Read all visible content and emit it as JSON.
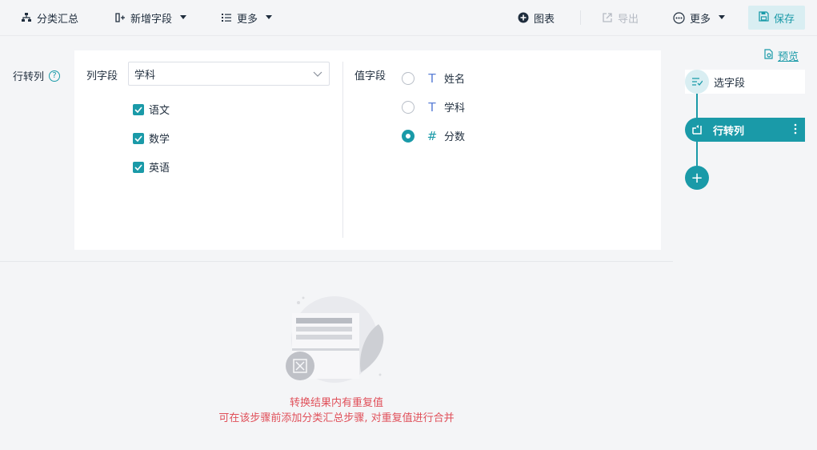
{
  "toolbar": {
    "group_summary": "分类汇总",
    "add_field": "新增字段",
    "more_left": "更多",
    "chart": "图表",
    "export": "导出",
    "more_right": "更多",
    "save": "保存"
  },
  "config": {
    "row_to_col_label": "行转列",
    "help_icon": "?",
    "column_field_label": "列字段",
    "column_field_value": "学科",
    "column_values": [
      {
        "label": "语文",
        "checked": true
      },
      {
        "label": "数学",
        "checked": true
      },
      {
        "label": "英语",
        "checked": true
      }
    ],
    "value_field_label": "值字段",
    "value_fields": [
      {
        "label": "姓名",
        "type": "T",
        "selected": false
      },
      {
        "label": "学科",
        "type": "T",
        "selected": false
      },
      {
        "label": "分数",
        "type": "#",
        "selected": true
      }
    ]
  },
  "result": {
    "warning_line1": "转换结果内有重复值",
    "warning_line2": "可在该步骤前添加分类汇总步骤, 对重复值进行合并"
  },
  "sidebar": {
    "preview": "预览",
    "steps": [
      {
        "label": "选字段",
        "active": false
      },
      {
        "label": "行转列",
        "active": true
      }
    ],
    "add_icon": "+"
  },
  "colors": {
    "accent": "#1a9aa8",
    "warning": "#e0505a"
  }
}
